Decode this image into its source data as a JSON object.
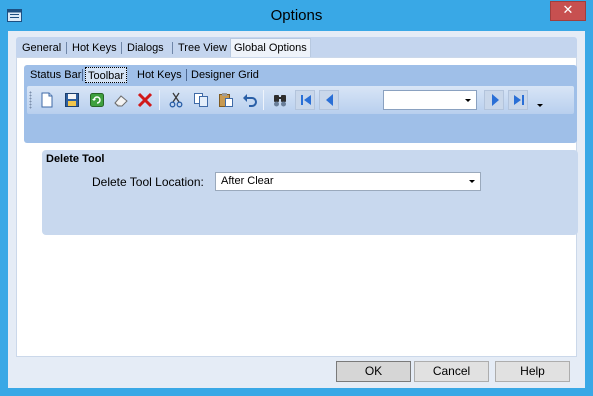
{
  "window": {
    "title": "Options",
    "close_icon": "close-icon"
  },
  "outer_tabs": [
    {
      "label": "General"
    },
    {
      "label": "Hot Keys"
    },
    {
      "label": "Dialogs"
    },
    {
      "label": "Tree View"
    },
    {
      "label": "Global Options",
      "active": true
    }
  ],
  "inner_tabs": [
    {
      "label": "Status Bar"
    },
    {
      "label": "Toolbar",
      "active": true
    },
    {
      "label": "Hot Keys"
    },
    {
      "label": "Designer Grid"
    }
  ],
  "toolbar": {
    "icons": [
      "new-file-icon",
      "save-icon",
      "refresh-icon",
      "eraser-icon",
      "delete-icon",
      "cut-icon",
      "copy-icon",
      "paste-icon",
      "undo-icon",
      "find-icon",
      "first-record-icon",
      "previous-record-icon",
      "next-record-icon",
      "last-record-icon",
      "overflow-icon"
    ],
    "record_select_value": ""
  },
  "delete_tool": {
    "header": "Delete Tool",
    "location_label": "Delete Tool Location:",
    "location_value": "After Clear"
  },
  "buttons": {
    "ok": "OK",
    "cancel": "Cancel",
    "help": "Help"
  },
  "colors": {
    "title_bar": "#39a8e6",
    "close_button": "#c75050",
    "tab_strip": "#9fbfe8",
    "group_box": "#c8d8ee"
  }
}
